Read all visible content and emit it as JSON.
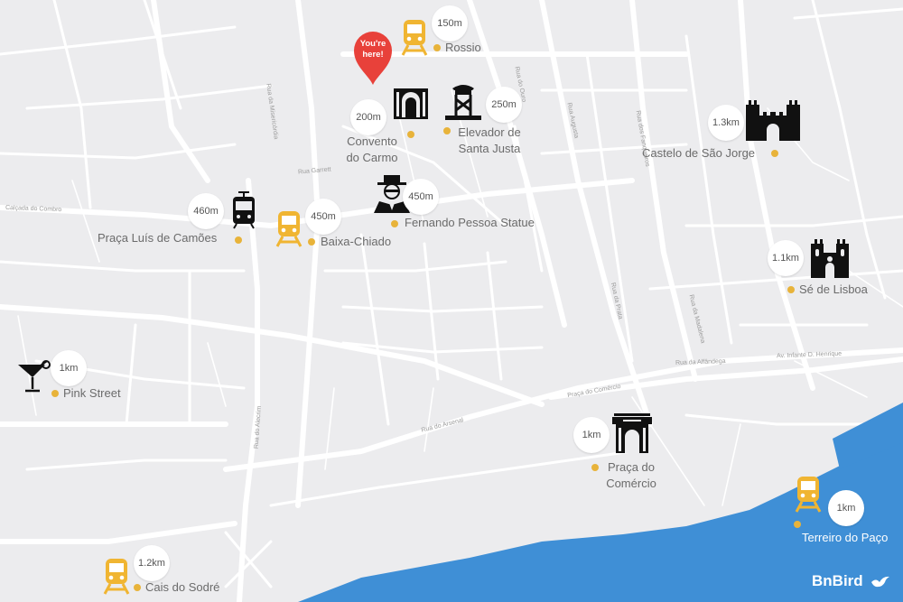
{
  "you_are_here": "You're\nhere!",
  "brand": "BnBird",
  "colors": {
    "water": "#3f8fd6",
    "pin": "#e8413a",
    "dot": "#e8b33a",
    "land": "#ececee",
    "road": "#ffffff",
    "transport_icon": "#f0b532",
    "landmark_icon": "#111111"
  },
  "pois": [
    {
      "name": "Rossio",
      "distance": "150m",
      "icon": "train-icon"
    },
    {
      "name": "Convento\ndo Carmo",
      "distance": "200m",
      "icon": "convent-icon"
    },
    {
      "name": "Elevador de\nSanta Justa",
      "distance": "250m",
      "icon": "elevator-tower-icon"
    },
    {
      "name": "Castelo de São Jorge",
      "distance": "1.3km",
      "icon": "castle-icon"
    },
    {
      "name": "Fernando Pessoa Statue",
      "distance": "450m",
      "icon": "pessoa-portrait-icon"
    },
    {
      "name": "Praça Luís de Camões",
      "distance": "460m",
      "icon": "tram-icon"
    },
    {
      "name": "Baixa-Chiado",
      "distance": "450m",
      "icon": "train-icon"
    },
    {
      "name": "Sé de Lisboa",
      "distance": "1.1km",
      "icon": "cathedral-icon"
    },
    {
      "name": "Pink Street",
      "distance": "1km",
      "icon": "cocktail-icon"
    },
    {
      "name": "Praça do\nComércio",
      "distance": "1km",
      "icon": "arch-icon"
    },
    {
      "name": "Terreiro do Paço",
      "distance": "1km",
      "icon": "train-icon"
    },
    {
      "name": "Cais do Sodré",
      "distance": "1.2km",
      "icon": "train-icon"
    }
  ],
  "streets": [
    "Calçada do Combro",
    "Rua do Arsenal",
    "Rua do Alecrim",
    "Rua da Prata",
    "Rua Augusta",
    "Rua dos Fanqueiros",
    "Rua da Madalena",
    "Rua do Ouro",
    "Rua da Alfândega",
    "Praça do Comércio",
    "Rua da Misericórdia",
    "Av. Infante D. Henrique",
    "Rua Garrett"
  ]
}
